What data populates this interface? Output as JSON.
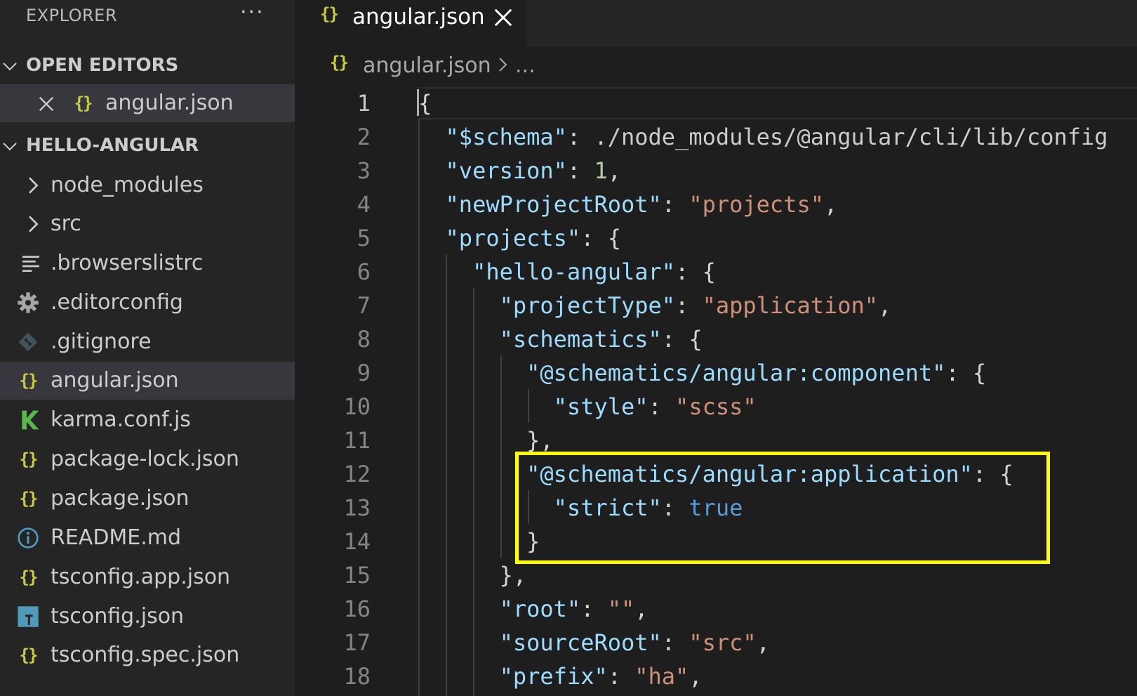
{
  "explorer": {
    "title": "EXPLORER",
    "more": "···",
    "open_editors": {
      "label": "OPEN EDITORS",
      "items": [
        {
          "label": "angular.json",
          "icon": "json-braces-icon"
        }
      ]
    },
    "project": {
      "label": "HELLO-ANGULAR",
      "items": [
        {
          "label": "node_modules",
          "icon": "chevron-right-icon"
        },
        {
          "label": "src",
          "icon": "chevron-right-icon"
        },
        {
          "label": ".browserslistrc",
          "icon": "lines-icon"
        },
        {
          "label": ".editorconfig",
          "icon": "gear-icon"
        },
        {
          "label": ".gitignore",
          "icon": "git-icon"
        },
        {
          "label": "angular.json",
          "icon": "json-braces-icon",
          "selected": true
        },
        {
          "label": "karma.conf.js",
          "icon": "karma-icon"
        },
        {
          "label": "package-lock.json",
          "icon": "json-braces-icon"
        },
        {
          "label": "package.json",
          "icon": "json-braces-icon"
        },
        {
          "label": "README.md",
          "icon": "info-icon"
        },
        {
          "label": "tsconfig.app.json",
          "icon": "json-braces-icon"
        },
        {
          "label": "tsconfig.json",
          "icon": "typescript-icon"
        },
        {
          "label": "tsconfig.spec.json",
          "icon": "json-braces-icon"
        }
      ]
    }
  },
  "tab": {
    "label": "angular.json",
    "icon": "json-braces-icon"
  },
  "breadcrumb": {
    "file": "angular.json",
    "ellipsis": "..."
  },
  "code": {
    "braces_glyph": "{}",
    "lines": [
      {
        "num": "1",
        "text": "{"
      },
      {
        "num": "2",
        "text": "  \"$schema\": \"./node_modules/@angular/cli/lib/config"
      },
      {
        "num": "3",
        "text": "  \"version\": 1,"
      },
      {
        "num": "4",
        "text": "  \"newProjectRoot\": \"projects\","
      },
      {
        "num": "5",
        "text": "  \"projects\": {"
      },
      {
        "num": "6",
        "text": "    \"hello-angular\": {"
      },
      {
        "num": "7",
        "text": "      \"projectType\": \"application\","
      },
      {
        "num": "8",
        "text": "      \"schematics\": {"
      },
      {
        "num": "9",
        "text": "        \"@schematics/angular:component\": {"
      },
      {
        "num": "10",
        "text": "          \"style\": \"scss\""
      },
      {
        "num": "11",
        "text": "        },"
      },
      {
        "num": "12",
        "text": "        \"@schematics/angular:application\": {"
      },
      {
        "num": "13",
        "text": "          \"strict\": true"
      },
      {
        "num": "14",
        "text": "        }"
      },
      {
        "num": "15",
        "text": "      },"
      },
      {
        "num": "16",
        "text": "      \"root\": \"\","
      },
      {
        "num": "17",
        "text": "      \"sourceRoot\": \"src\","
      },
      {
        "num": "18",
        "text": "      \"prefix\": \"ha\","
      }
    ]
  },
  "colors": {
    "highlight_box": "#ffff00",
    "json_icon": "#cbcb41",
    "key": "#9cdcfe",
    "string": "#ce9178",
    "number": "#b5cea8",
    "boolean": "#569cd6"
  }
}
